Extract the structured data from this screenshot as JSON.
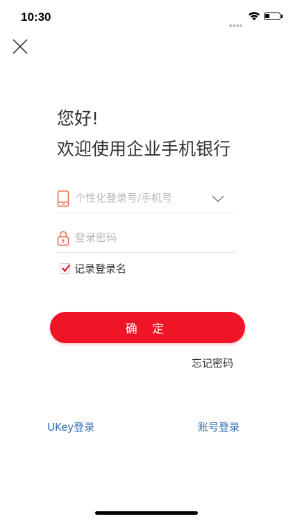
{
  "status_bar": {
    "time": "10:30"
  },
  "greeting": {
    "line1": "您好!",
    "line2": "欢迎使用企业手机银行"
  },
  "login_form": {
    "username_placeholder": "个性化登录号/手机号",
    "username_value": "",
    "password_placeholder": "登录密码",
    "password_value": "",
    "remember_label": "记录登录名",
    "remember_checked": true
  },
  "actions": {
    "confirm_label": "确 定",
    "forgot_label": "忘记密码",
    "ukey_login_label": "UKey登录",
    "account_login_label": "账号登录"
  },
  "icons": {
    "close": "close-icon",
    "phone": "phone-icon",
    "lock": "lock-icon",
    "chevron": "chevron-down-icon",
    "check": "checkmark-icon"
  },
  "colors": {
    "primary": "#f01427",
    "link": "#2d6db5",
    "icon_accent": "#e8714f",
    "text": "#333333",
    "placeholder": "#b8b8b8"
  }
}
